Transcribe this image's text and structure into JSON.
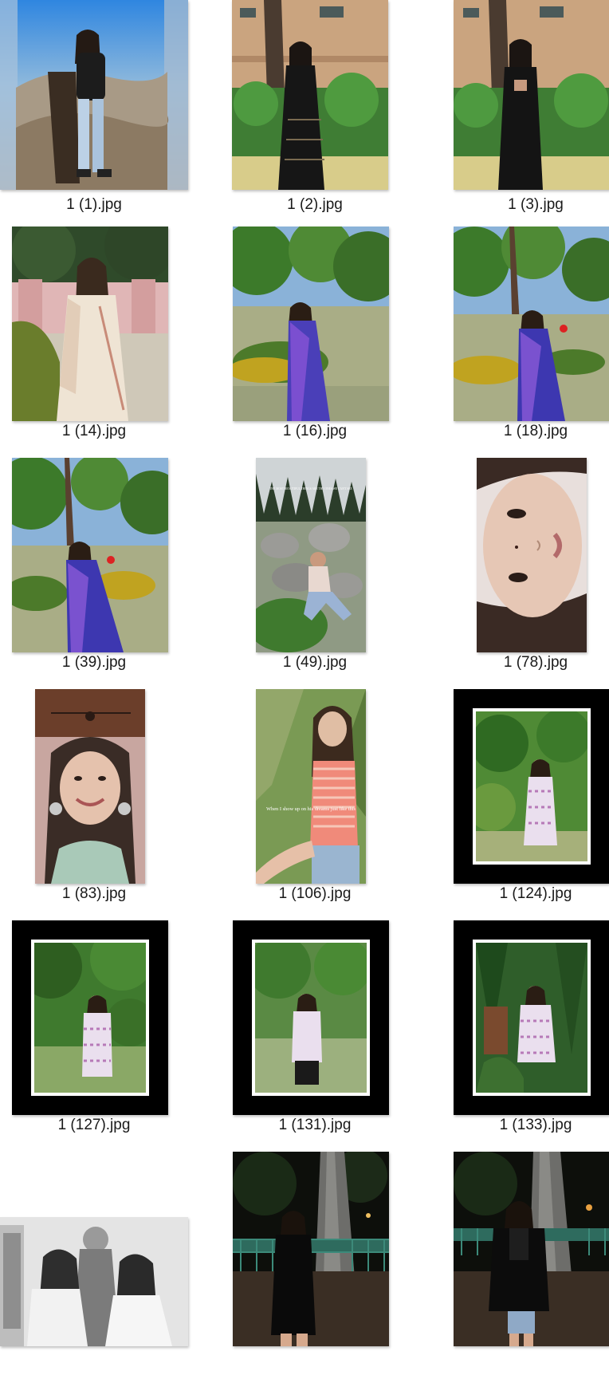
{
  "files": [
    {
      "name": "1 (1).jpg"
    },
    {
      "name": "1 (2).jpg"
    },
    {
      "name": "1 (3).jpg"
    },
    {
      "name": "1 (14).jpg"
    },
    {
      "name": "1 (16).jpg"
    },
    {
      "name": "1 (18).jpg"
    },
    {
      "name": "1 (39).jpg"
    },
    {
      "name": "1 (49).jpg"
    },
    {
      "name": "1 (78).jpg"
    },
    {
      "name": "1 (83).jpg"
    },
    {
      "name": "1 (106).jpg"
    },
    {
      "name": "1 (124).jpg"
    },
    {
      "name": "1 (127).jpg"
    },
    {
      "name": "1 (131).jpg"
    },
    {
      "name": "1 (133).jpg"
    },
    {
      "name": ""
    },
    {
      "name": ""
    },
    {
      "name": ""
    }
  ],
  "overlay_texts": {
    "photo_49_caption": "THE MOST BEAUTIFUL THINGS ARE THE ONES WE CAN'T SEE",
    "photo_106_caption": "When I show up on his dreams just like this"
  },
  "colors": {
    "background": "#ffffff",
    "label_text": "#1a1a1a",
    "frame_black": "#000000"
  }
}
